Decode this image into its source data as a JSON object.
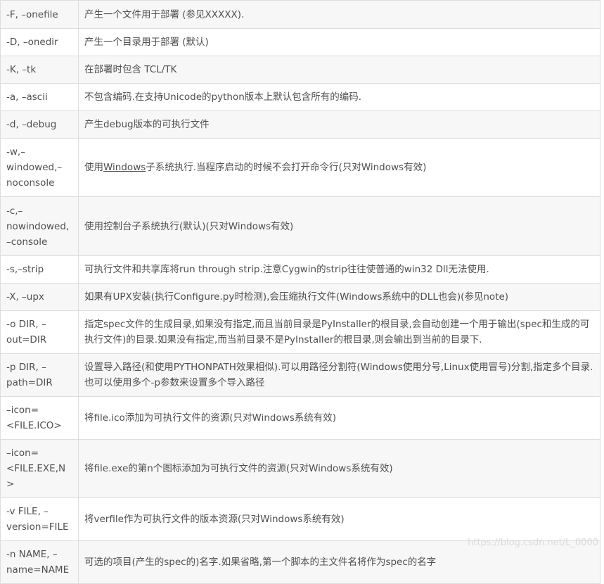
{
  "rows": [
    {
      "option": "-F, –onefile",
      "desc": "产生一个文件用于部署 (参见XXXXX)."
    },
    {
      "option": "-D, –onedir",
      "desc": "产生一个目录用于部署 (默认)"
    },
    {
      "option": "-K, –tk",
      "desc": "在部署时包含 TCL/TK"
    },
    {
      "option": "-a, –ascii",
      "desc": "不包含编码.在支持Unicode的python版本上默认包含所有的编码."
    },
    {
      "option": "-d, –debug",
      "desc": "产生debug版本的可执行文件"
    },
    {
      "option": "-w,–windowed,–noconsole",
      "desc_pre": "使用",
      "desc_link": "Windows",
      "desc_post": "子系统执行.当程序启动的时候不会打开命令行(只对Windows有效)"
    },
    {
      "option": "-c,–nowindowed,–console",
      "desc": "使用控制台子系统执行(默认)(只对Windows有效)"
    },
    {
      "option": "-s,–strip",
      "desc": "可执行文件和共享库将run through strip.注意Cygwin的strip往往使普通的win32 Dll无法使用."
    },
    {
      "option": "-X, –upx",
      "desc": "如果有UPX安装(执行Configure.py时检测),会压缩执行文件(Windows系统中的DLL也会)(参见note)"
    },
    {
      "option": "-o DIR, –out=DIR",
      "desc": "指定spec文件的生成目录,如果没有指定,而且当前目录是PyInstaller的根目录,会自动创建一个用于输出(spec和生成的可执行文件)的目录.如果没有指定,而当前目录不是PyInstaller的根目录,则会输出到当前的目录下."
    },
    {
      "option": "-p DIR, –path=DIR",
      "desc": "设置导入路径(和使用PYTHONPATH效果相似).可以用路径分割符(Windows使用分号,Linux使用冒号)分割,指定多个目录.也可以使用多个-p参数来设置多个导入路径"
    },
    {
      "option": "–icon=<FILE.ICO>",
      "desc": "将file.ico添加为可执行文件的资源(只对Windows系统有效)"
    },
    {
      "option": "–icon=<FILE.EXE,N>",
      "desc": "将file.exe的第n个图标添加为可执行文件的资源(只对Windows系统有效)"
    },
    {
      "option": "-v FILE, –version=FILE",
      "desc": "将verfile作为可执行文件的版本资源(只对Windows系统有效)"
    },
    {
      "option": "-n NAME, –name=NAME",
      "desc": "可选的项目(产生的spec的)名字.如果省略,第一个脚本的主文件名将作为spec的名字"
    }
  ],
  "watermark": "https://blog.csdn.net/L_0000"
}
